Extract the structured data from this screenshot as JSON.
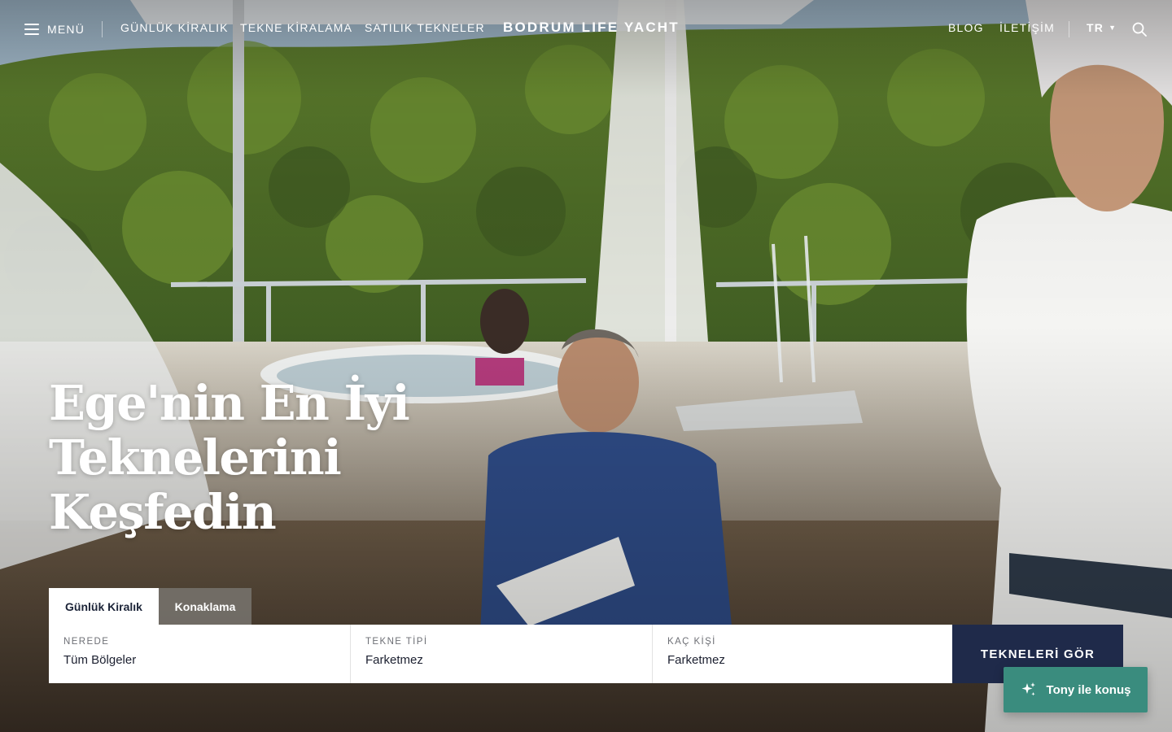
{
  "header": {
    "menu_label": "MENÜ",
    "nav_left": [
      "GÜNLÜK KİRALIK",
      "TEKNE KİRALAMA",
      "SATILIK TEKNELER"
    ],
    "brand": "BODRUM LIFE YACHT",
    "nav_right": [
      "BLOG",
      "İLETİŞİM"
    ],
    "language": "TR",
    "icons": {
      "menu": "hamburger-icon",
      "language": "caret-down-icon",
      "search": "search-icon"
    }
  },
  "hero": {
    "headline_lines": [
      "Ege'nin En İyi",
      "Teknelerini",
      "Keşfedin"
    ]
  },
  "search": {
    "tabs": [
      {
        "label": "Günlük Kiralık",
        "active": true
      },
      {
        "label": "Konaklama",
        "active": false
      }
    ],
    "fields": [
      {
        "label": "NEREDE",
        "value": "Tüm Bölgeler"
      },
      {
        "label": "TEKNE TİPİ",
        "value": "Farketmez"
      },
      {
        "label": "KAÇ KİŞİ",
        "value": "Farketmez"
      }
    ],
    "submit_label": "TEKNELERİ GÖR"
  },
  "chat": {
    "label": "Tony ile konuş",
    "icon": "sparkle-icon"
  },
  "colors": {
    "brand_navy": "#1f2a4a",
    "chat_teal": "#3a8c7e",
    "inactive_tab": "#78746e"
  }
}
